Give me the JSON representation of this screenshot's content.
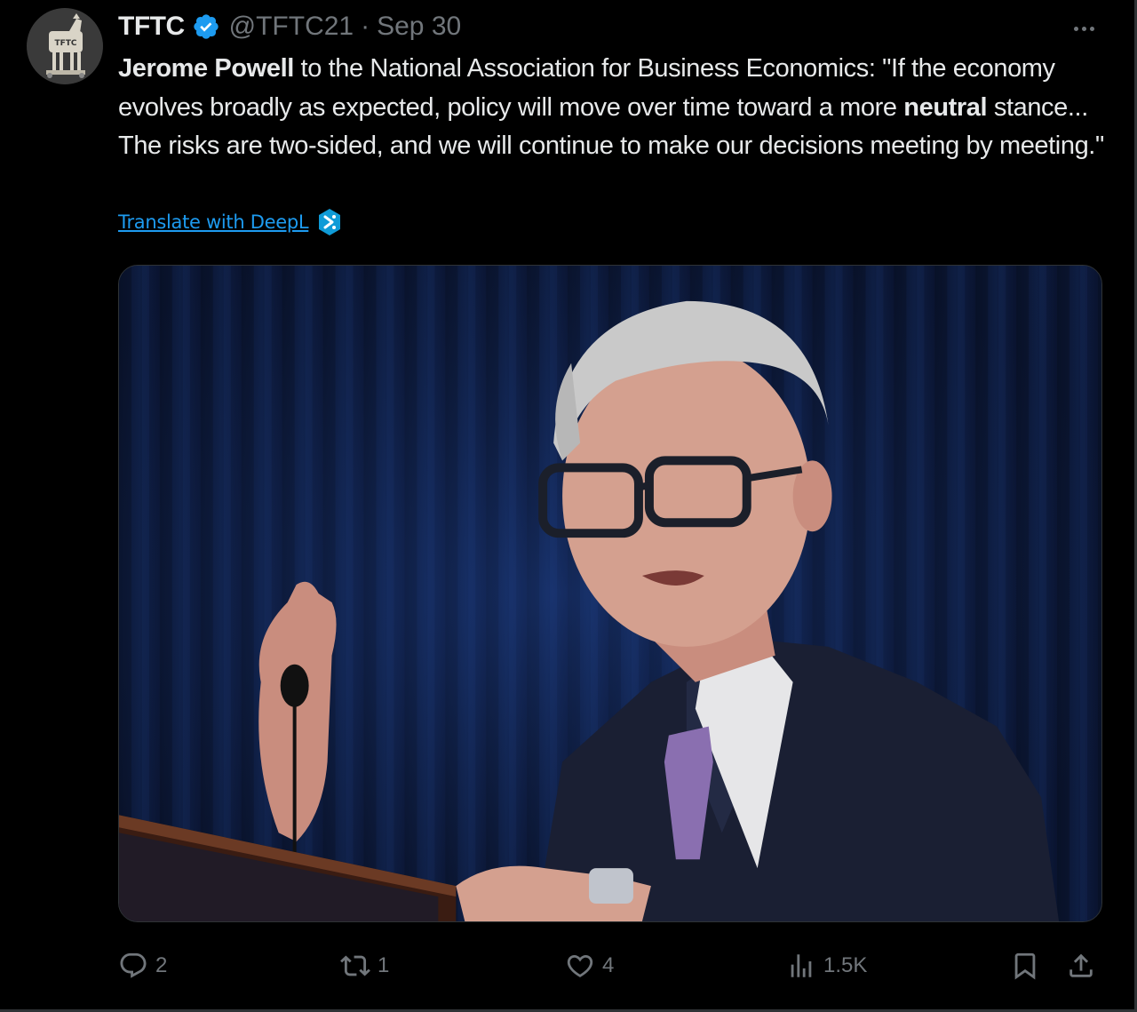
{
  "tweet": {
    "author": {
      "display_name": "TFTC",
      "verified": true,
      "handle": "@TFTC21",
      "separator": "·",
      "date": "Sep 30"
    },
    "text": {
      "segments": [
        {
          "text": "Jerome Powell",
          "bold": true
        },
        {
          "text": " to the National Association for Business Economics: \"If the economy evolves broadly as expected, policy will move over time toward a more ",
          "bold": false
        },
        {
          "text": "neutral",
          "bold": true
        },
        {
          "text": " stance... The risks are two-sided, and we will continue to make our decisions meeting by meeting.\"",
          "bold": false
        }
      ]
    },
    "translate_label": "Translate with DeepL",
    "actions": {
      "replies": "2",
      "reposts": "1",
      "likes": "4",
      "views": "1.5K"
    },
    "icons": {
      "avatar": "trojan-horse-avatar",
      "verified": "verified-badge-icon",
      "more": "more-icon",
      "translate": "deepl-icon",
      "reply": "reply-icon",
      "repost": "repost-icon",
      "like": "heart-icon",
      "views": "views-icon",
      "bookmark": "bookmark-icon",
      "share": "share-icon"
    },
    "colors": {
      "background": "#000000",
      "text": "#e7e9ea",
      "muted": "#71767b",
      "accent": "#1d9bf0"
    }
  }
}
